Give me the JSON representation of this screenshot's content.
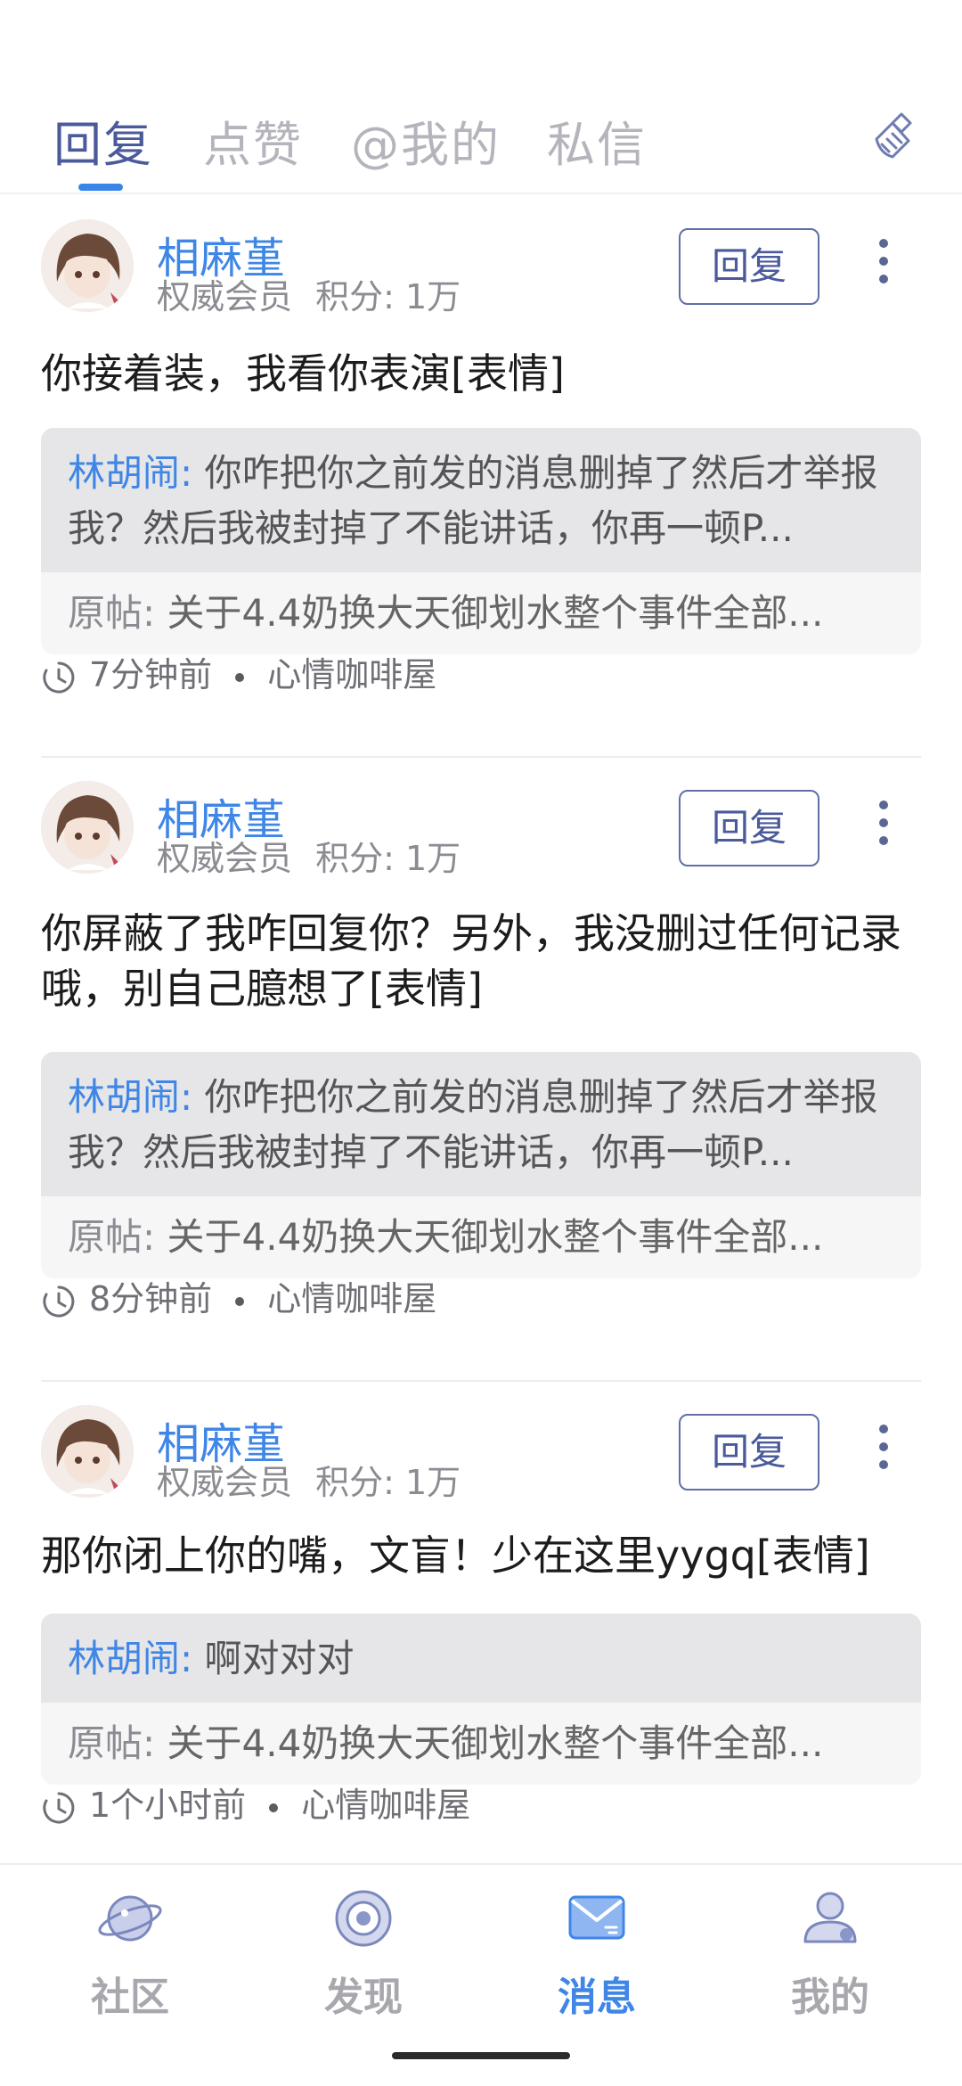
{
  "tabs": [
    {
      "label": "回复",
      "active": true
    },
    {
      "label": "点赞",
      "active": false
    },
    {
      "label": "@我的",
      "active": false
    },
    {
      "label": "私信",
      "active": false
    }
  ],
  "toolbar": {
    "clean_icon": "broom-icon"
  },
  "items": [
    {
      "username": "相麻堇",
      "role": "权威会员",
      "points": "积分: 1万",
      "reply_label": "回复",
      "content": "你接着装，我看你表演[表情]",
      "quote_name": "林胡闹:",
      "quote_text": "你咋把你之前发的消息删掉了然后才举报我？然后我被封掉了不能讲话，你再一顿P...",
      "origin_label": "原帖:",
      "origin_text": "关于4.4奶换大天御划水整个事件全部...",
      "time": "7分钟前",
      "board": "心情咖啡屋"
    },
    {
      "username": "相麻堇",
      "role": "权威会员",
      "points": "积分: 1万",
      "reply_label": "回复",
      "content": "你屏蔽了我咋回复你？另外，我没删过任何记录哦，别自己臆想了[表情]",
      "quote_name": "林胡闹:",
      "quote_text": "你咋把你之前发的消息删掉了然后才举报我？然后我被封掉了不能讲话，你再一顿P...",
      "origin_label": "原帖:",
      "origin_text": "关于4.4奶换大天御划水整个事件全部...",
      "time": "8分钟前",
      "board": "心情咖啡屋"
    },
    {
      "username": "相麻堇",
      "role": "权威会员",
      "points": "积分: 1万",
      "reply_label": "回复",
      "content": "那你闭上你的嘴，文盲！少在这里yygq[表情]",
      "quote_name": "林胡闹:",
      "quote_text": "啊对对对",
      "origin_label": "原帖:",
      "origin_text": "关于4.4奶换大天御划水整个事件全部...",
      "time": "1个小时前",
      "board": "心情咖啡屋"
    }
  ],
  "bottom_nav": [
    {
      "label": "社区",
      "icon": "planet-icon",
      "active": false
    },
    {
      "label": "发现",
      "icon": "discover-icon",
      "active": false
    },
    {
      "label": "消息",
      "icon": "mail-icon",
      "active": true
    },
    {
      "label": "我的",
      "icon": "profile-icon",
      "active": false
    }
  ],
  "colors": {
    "accent": "#3f86e6",
    "tab_active": "#4a5a9a",
    "tab_inactive": "#b4b4bc"
  }
}
